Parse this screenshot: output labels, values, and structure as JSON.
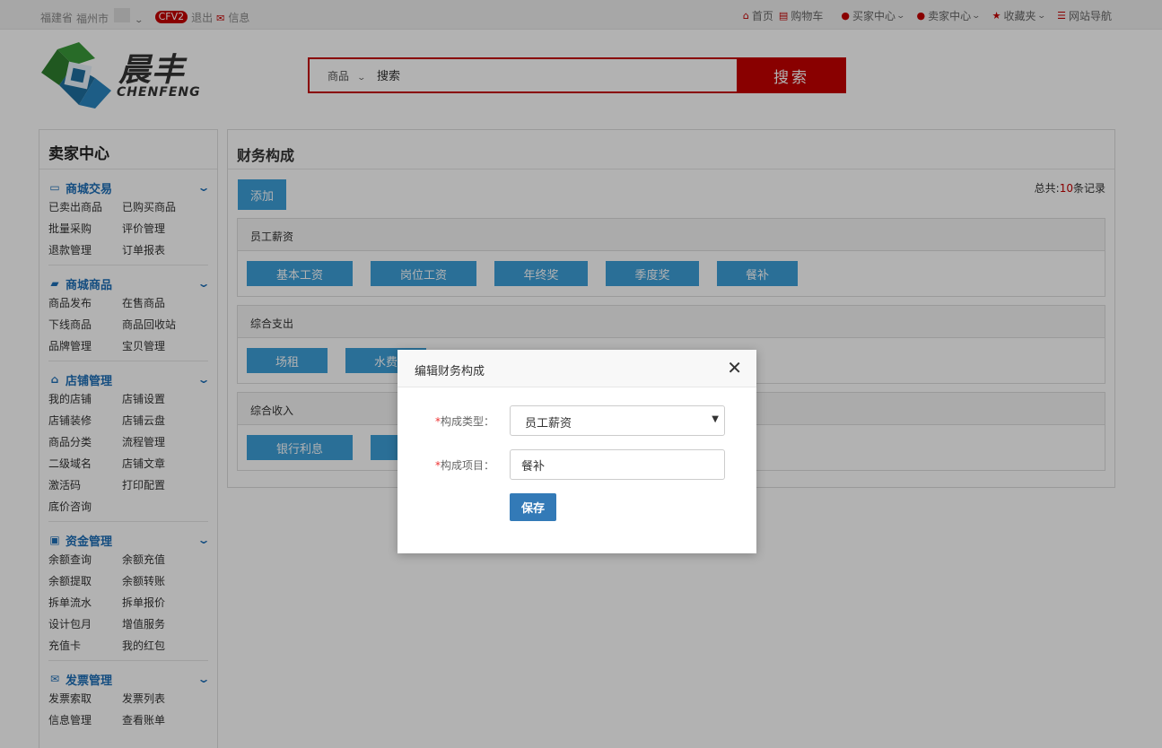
{
  "topbar": {
    "province": "福建省",
    "city": "福州市",
    "badge": "CFV2",
    "logout": "退出",
    "message": "信息",
    "nav": [
      {
        "label": "首页",
        "icon": "home-icon"
      },
      {
        "label": "购物车",
        "icon": "cart-icon"
      },
      {
        "label": "买家中心",
        "icon": "user-icon",
        "dropdown": true
      },
      {
        "label": "卖家中心",
        "icon": "user-icon",
        "dropdown": true
      },
      {
        "label": "收藏夹",
        "icon": "star-icon",
        "dropdown": true
      },
      {
        "label": "网站导航",
        "icon": "list-icon"
      }
    ]
  },
  "header": {
    "logo_cn": "晨丰",
    "logo_en": "CHENFENG",
    "search_category": "商品",
    "search_value": "搜索",
    "search_button": "搜索"
  },
  "sidebar": {
    "title": "卖家中心",
    "groups": [
      {
        "name": "商城交易",
        "icon": "card-icon",
        "links": [
          "已卖出商品",
          "已购买商品",
          "批量采购",
          "评价管理",
          "退款管理",
          "订单报表"
        ]
      },
      {
        "name": "商城商品",
        "icon": "truck-icon",
        "links": [
          "商品发布",
          "在售商品",
          "下线商品",
          "商品回收站",
          "品牌管理",
          "宝贝管理"
        ]
      },
      {
        "name": "店铺管理",
        "icon": "home-icon",
        "links": [
          "我的店铺",
          "店铺设置",
          "店铺装修",
          "店铺云盘",
          "商品分类",
          "流程管理",
          "二级域名",
          "店铺文章",
          "激活码",
          "打印配置",
          "底价咨询"
        ]
      },
      {
        "name": "资金管理",
        "icon": "money-icon",
        "links": [
          "余额查询",
          "余额充值",
          "余额提取",
          "余额转账",
          "拆单流水",
          "拆单报价",
          "设计包月",
          "增值服务",
          "充值卡",
          "我的红包"
        ]
      },
      {
        "name": "发票管理",
        "icon": "mail-icon",
        "links": [
          "发票索取",
          "发票列表",
          "信息管理",
          "查看账单"
        ]
      }
    ]
  },
  "main": {
    "title": "财务构成",
    "add_button": "添加",
    "total_prefix": "总共:",
    "total_count": "10",
    "total_suffix": "条记录",
    "panels": [
      {
        "name": "员工薪资",
        "tags": [
          "基本工资",
          "岗位工资",
          "年终奖",
          "季度奖",
          "餐补"
        ]
      },
      {
        "name": "综合支出",
        "tags": [
          "场租",
          "水费"
        ]
      },
      {
        "name": "综合收入",
        "tags": [
          "银行利息",
          ""
        ]
      }
    ]
  },
  "modal": {
    "title": "编辑财务构成",
    "type_label": "构成类型：",
    "type_value": "员工薪资",
    "item_label": "构成项目：",
    "item_value": "餐补",
    "required_mark": "*",
    "save_button": "保存"
  },
  "colors": {
    "brand_red": "#c40000",
    "tag_blue": "#3d9fd9",
    "save_blue": "#337ab7",
    "sidebar_blue": "#1e6fb8"
  }
}
